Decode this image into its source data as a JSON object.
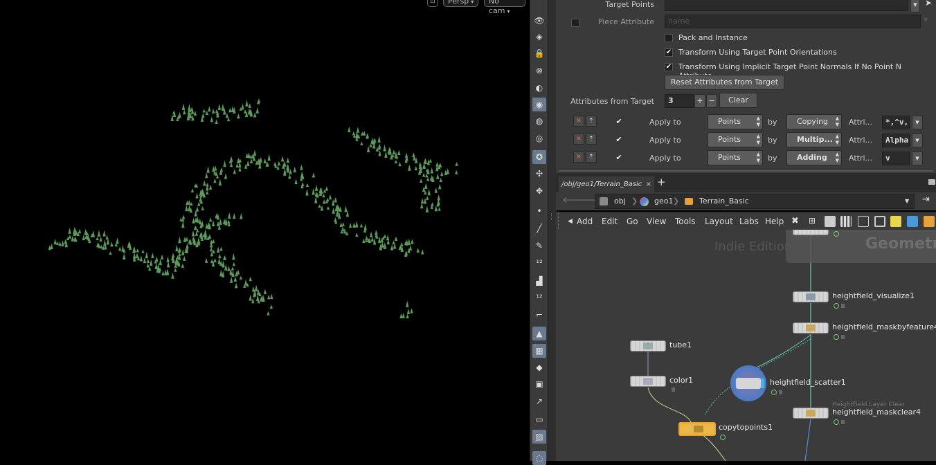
{
  "viewport": {
    "camera_mode": "Persp",
    "camera": "No cam",
    "foliage_color": "#5c9a5c"
  },
  "params": {
    "target_points_label": "Target Points",
    "target_points_value": "",
    "piece_attribute_label": "Piece Attribute",
    "piece_attribute_placeholder": "name",
    "pack_and_instance": {
      "label": "Pack and Instance",
      "checked": false
    },
    "transform_orient": {
      "label": "Transform Using Target Point Orientations",
      "checked": true
    },
    "transform_normals": {
      "label": "Transform Using Implicit Target Point Normals If No Point N Attribute",
      "checked": true
    },
    "reset_button": "Reset Attributes from Target",
    "attr_from_target_label": "Attributes from Target",
    "attr_from_target_value": "3",
    "plus": "+",
    "minus": "−",
    "clear_button": "Clear",
    "rows": [
      {
        "apply_label": "Apply to",
        "apply": "Points",
        "by_label": "by",
        "by": "Copying",
        "attr_label": "Attri...",
        "attr": "*,^v,"
      },
      {
        "apply_label": "Apply to",
        "apply": "Points",
        "by_label": "by",
        "by": "Multip...",
        "attr_label": "Attri...",
        "attr": "Alpha"
      },
      {
        "apply_label": "Apply to",
        "apply": "Points",
        "by_label": "by",
        "by": "Adding",
        "attr_label": "Attri...",
        "attr": "v"
      }
    ]
  },
  "tabs": {
    "active": "/obj/geo1/Terrain_Basic",
    "close": "×",
    "add": "+"
  },
  "path": {
    "crumbs": [
      "obj",
      "geo1",
      "Terrain_Basic"
    ]
  },
  "menu": {
    "items": [
      "Add",
      "Edit",
      "Go",
      "View",
      "Tools",
      "Layout",
      "Labs",
      "Help"
    ]
  },
  "network": {
    "watermark": "Indie Edition",
    "context_label": "Geometr",
    "nodes": [
      {
        "name": "heightfield_visualize1"
      },
      {
        "name": "heightfield_maskbyfeature4"
      },
      {
        "name": "tube1"
      },
      {
        "name": "color1"
      },
      {
        "name": "heightfield_scatter1"
      },
      {
        "name": "heightfield_maskclear4",
        "comment": "HeightField Layer Clear"
      },
      {
        "name": "copytopoints1"
      }
    ]
  },
  "colors": {
    "panel_bg": "#3a3a3a",
    "selected_node": "#f2b830",
    "wire": "#5ec8b8",
    "scatter_ring": "#4a7ac8"
  }
}
